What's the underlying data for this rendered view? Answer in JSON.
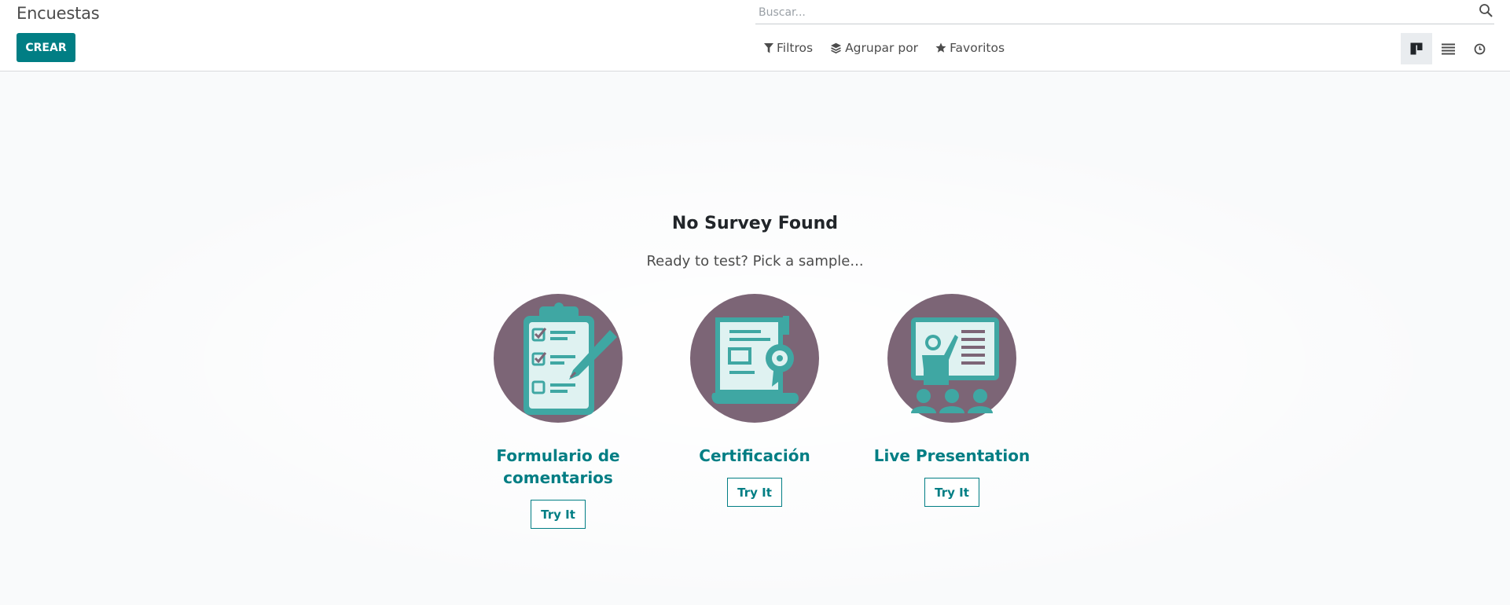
{
  "header": {
    "title": "Encuestas",
    "create_label": "CREAR"
  },
  "search": {
    "placeholder": "Buscar..."
  },
  "filters": {
    "filter_label": "Filtros",
    "group_label": "Agrupar por",
    "favorites_label": "Favoritos"
  },
  "views": [
    {
      "icon": "kanban-view-icon",
      "active": true
    },
    {
      "icon": "list-view-icon",
      "active": false
    },
    {
      "icon": "activity-view-icon",
      "active": false
    }
  ],
  "help": {
    "title": "No Survey Found",
    "subtitle": "Ready to test? Pick a sample..."
  },
  "samples": [
    {
      "label": "Formulario de comentarios",
      "button": "Try It",
      "icon": "clipboard-checklist-icon"
    },
    {
      "label": "Certificación",
      "button": "Try It",
      "icon": "certificate-scroll-icon"
    },
    {
      "label": "Live Presentation",
      "button": "Try It",
      "icon": "presentation-icon"
    }
  ],
  "colors": {
    "primary": "#017e84",
    "illustration_bg": "#7c6576",
    "illustration_teal": "#3fa7a3"
  }
}
